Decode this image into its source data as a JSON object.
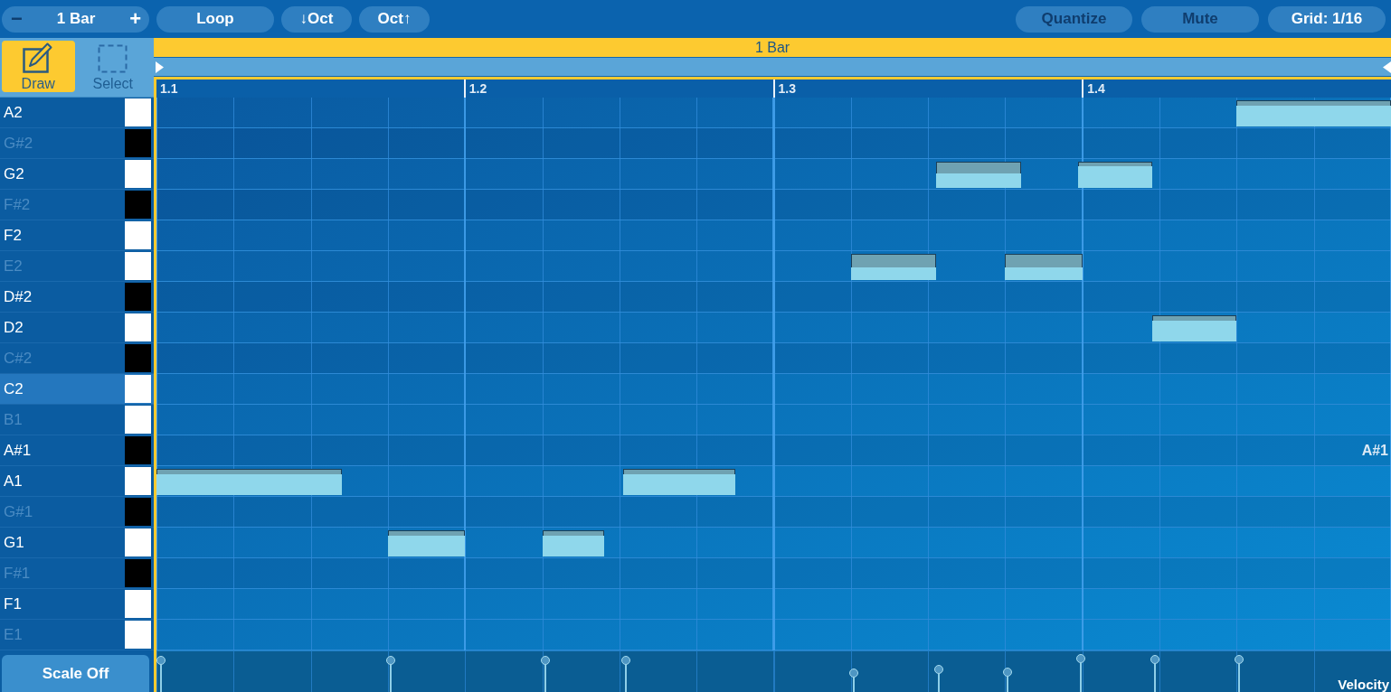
{
  "toolbar": {
    "length_stepper": {
      "decrement": {
        "label": "−",
        "disabled": true
      },
      "value": "1 Bar",
      "increment": {
        "label": "+",
        "disabled": false
      }
    },
    "left_buttons": [
      {
        "label": "Loop",
        "disabled": false
      },
      {
        "label": "↓Oct",
        "disabled": false
      },
      {
        "label": "Oct↑",
        "disabled": false
      }
    ],
    "right_buttons": [
      {
        "label": "Quantize",
        "disabled": true
      },
      {
        "label": "Mute",
        "disabled": true
      },
      {
        "label": "Grid: 1/16",
        "disabled": false
      }
    ]
  },
  "tools": [
    {
      "kind": "draw",
      "label": "Draw",
      "selected": true
    },
    {
      "kind": "select",
      "label": "Select",
      "selected": false
    }
  ],
  "region": {
    "label": "1 Bar"
  },
  "ruler": {
    "marks": [
      "1.1",
      "1.2",
      "1.3",
      "1.4"
    ]
  },
  "rows": [
    {
      "label": "A2",
      "kind": "white",
      "dimmed": false,
      "selected": false
    },
    {
      "label": "G#2",
      "kind": "black",
      "dimmed": true,
      "selected": false
    },
    {
      "label": "G2",
      "kind": "white",
      "dimmed": false,
      "selected": false
    },
    {
      "label": "F#2",
      "kind": "black",
      "dimmed": true,
      "selected": false
    },
    {
      "label": "F2",
      "kind": "white",
      "dimmed": false,
      "selected": false
    },
    {
      "label": "E2",
      "kind": "white",
      "dimmed": true,
      "selected": false
    },
    {
      "label": "D#2",
      "kind": "black",
      "dimmed": false,
      "selected": false
    },
    {
      "label": "D2",
      "kind": "white",
      "dimmed": false,
      "selected": false
    },
    {
      "label": "C#2",
      "kind": "black",
      "dimmed": true,
      "selected": false
    },
    {
      "label": "C2",
      "kind": "white",
      "dimmed": false,
      "selected": true
    },
    {
      "label": "B1",
      "kind": "white",
      "dimmed": true,
      "selected": false
    },
    {
      "label": "A#1",
      "kind": "black",
      "dimmed": false,
      "selected": false,
      "side_label": "A#1"
    },
    {
      "label": "A1",
      "kind": "white",
      "dimmed": false,
      "selected": false
    },
    {
      "label": "G#1",
      "kind": "black",
      "dimmed": true,
      "selected": false
    },
    {
      "label": "G1",
      "kind": "white",
      "dimmed": false,
      "selected": false
    },
    {
      "label": "F#1",
      "kind": "black",
      "dimmed": true,
      "selected": false
    },
    {
      "label": "F1",
      "kind": "white",
      "dimmed": false,
      "selected": false
    },
    {
      "label": "E1",
      "kind": "white",
      "dimmed": true,
      "selected": false
    }
  ],
  "velocity_lane": {
    "label": "Velocity"
  },
  "scale_button": {
    "label": "Scale Off"
  }
}
